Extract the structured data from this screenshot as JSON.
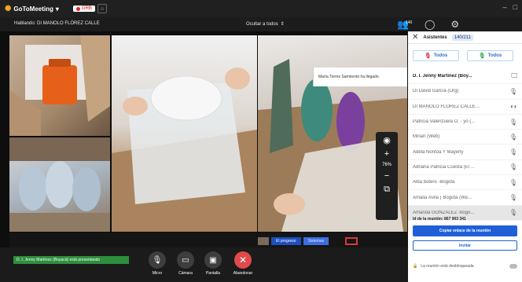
{
  "topbar": {
    "app_name": "GoToMeeting",
    "rec_label": "GRB",
    "window_controls": [
      "–",
      "□"
    ]
  },
  "subbar": {
    "speaking_text": "Hablando: DI MANOLO FLÓREZ CALLE",
    "hide_all_label": "Ocultar a todos",
    "attendee_count": "140"
  },
  "stage": {
    "notification": "María Torres Sarmiento ha llegado.",
    "progress_label": "El progreso",
    "progress_sub": "Sistemas",
    "zoom_percent": "76%"
  },
  "panel": {
    "title": "Asistentes",
    "count": "140/211",
    "filter_all_1": "Todos",
    "filter_all_2": "Todos",
    "participants": [
      {
        "name": "D. I. Jenny Martínez (Boy...",
        "icon": "🖵"
      },
      {
        "name": "DI David García  (Org)",
        "icon": "🎙"
      },
      {
        "name": "DI MANOLO FLÓREZ CALLE...",
        "icon": "◖◗"
      },
      {
        "name": "Patricia Valenzuela O. - yo (...",
        "icon": "🎙"
      },
      {
        "name": "Mirian  (Web)",
        "icon": "🎙"
      },
      {
        "name": "Adela Nontoa Y Mayerly",
        "icon": "🎙"
      },
      {
        "name": "Adriana Patricia Cuesta (El ...",
        "icon": "🎙"
      },
      {
        "name": "Alba botero -Bogotá",
        "icon": "🎙"
      },
      {
        "name": "Amalia Ávila ( Bogotá (We...",
        "icon": "🎙"
      },
      {
        "name": "Amanda GONZÁLEZ -bogo...",
        "icon": "🎙"
      }
    ],
    "meeting_id_label": "Id de la reunión:  867 903 341",
    "copy_link": "Copiar enlace de la reunión",
    "invite": "Invitar",
    "unlocked_text": "La reunión está desbloqueada"
  },
  "bottombar": {
    "presenting_text": "D. I. Jenny Martínez (Boyacá) está presentando",
    "mic": "Micro",
    "camera": "Cámara",
    "screen": "Pantalla",
    "leave": "Abandonar"
  },
  "colors": {
    "accent_blue": "#1f60d9",
    "leave_red": "#e04a4a",
    "presenting_green": "#2e8f3d"
  }
}
